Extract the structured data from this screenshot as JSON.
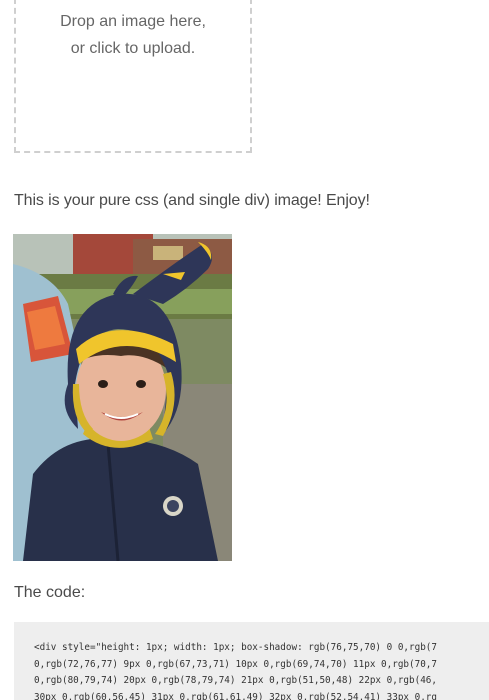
{
  "upload": {
    "line1": "Drop an image here,",
    "line2": "or click to upload."
  },
  "message": "This is your pure css (and single div) image! Enjoy!",
  "code_label": "The code:",
  "code_lines": [
    "<div style=\"height: 1px; width: 1px; box-shadow: rgb(76,75,70) 0 0,rgb(7",
    "0,rgb(72,76,77) 9px 0,rgb(67,73,71) 10px 0,rgb(69,74,70) 11px 0,rgb(70,7",
    "0,rgb(80,79,74) 20px 0,rgb(78,79,74) 21px 0,rgb(51,50,48) 22px 0,rgb(46,",
    "30px 0,rgb(60,56,45) 31px 0,rgb(61,61,49) 32px 0,rgb(52,54,41) 33px 0,rg"
  ],
  "colors": {
    "dropzone_border": "#cfcfcf",
    "code_bg": "#eeeeee",
    "text": "#4a4a4a"
  }
}
